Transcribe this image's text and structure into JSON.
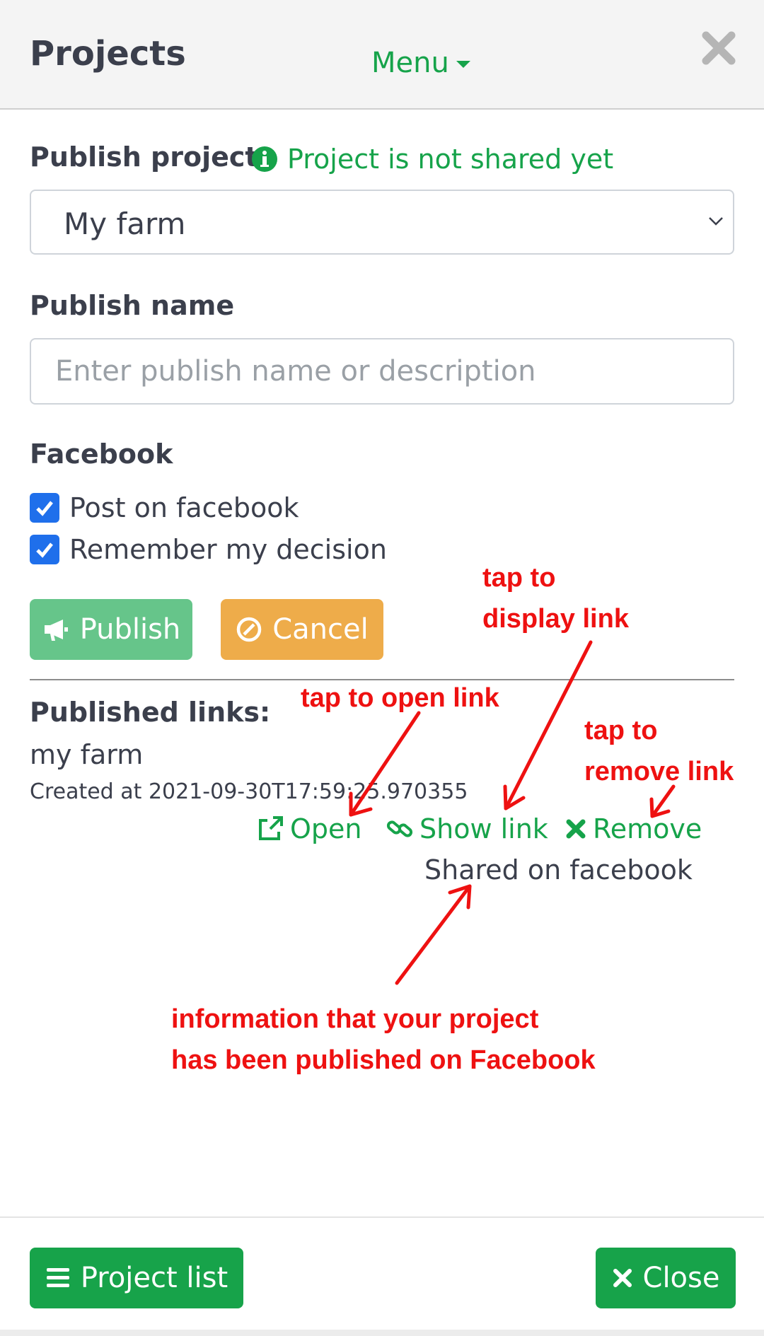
{
  "header": {
    "title": "Projects",
    "menu_label": "Menu"
  },
  "publish_project": {
    "label": "Publish project",
    "status": "Project is not shared yet",
    "selected_project": "My farm"
  },
  "publish_name": {
    "label": "Publish name",
    "placeholder": "Enter publish name or description",
    "value": ""
  },
  "facebook": {
    "label": "Facebook",
    "options": [
      {
        "label": "Post on facebook",
        "checked": true
      },
      {
        "label": "Remember my decision",
        "checked": true
      }
    ]
  },
  "actions": {
    "publish_label": "Publish",
    "cancel_label": "Cancel"
  },
  "published_links": {
    "label": "Published links:",
    "items": [
      {
        "name": "my farm",
        "created": "Created at 2021-09-30T17:59:25.970355",
        "open_label": "Open",
        "show_link_label": "Show link",
        "remove_label": "Remove",
        "status": "Shared on facebook"
      }
    ]
  },
  "annotations": {
    "display_link": "tap to\ndisplay link",
    "open_link": "tap to open link",
    "remove_link": "tap to\nremove link",
    "published_info": "information that your project\nhas been published on Facebook"
  },
  "footer": {
    "project_list_label": "Project list",
    "close_label": "Close"
  },
  "colors": {
    "accent_green": "#16a34a",
    "checkbox_blue": "#1f6feb",
    "cancel_orange": "#eeac4a",
    "annotation_red": "#ee1111"
  }
}
